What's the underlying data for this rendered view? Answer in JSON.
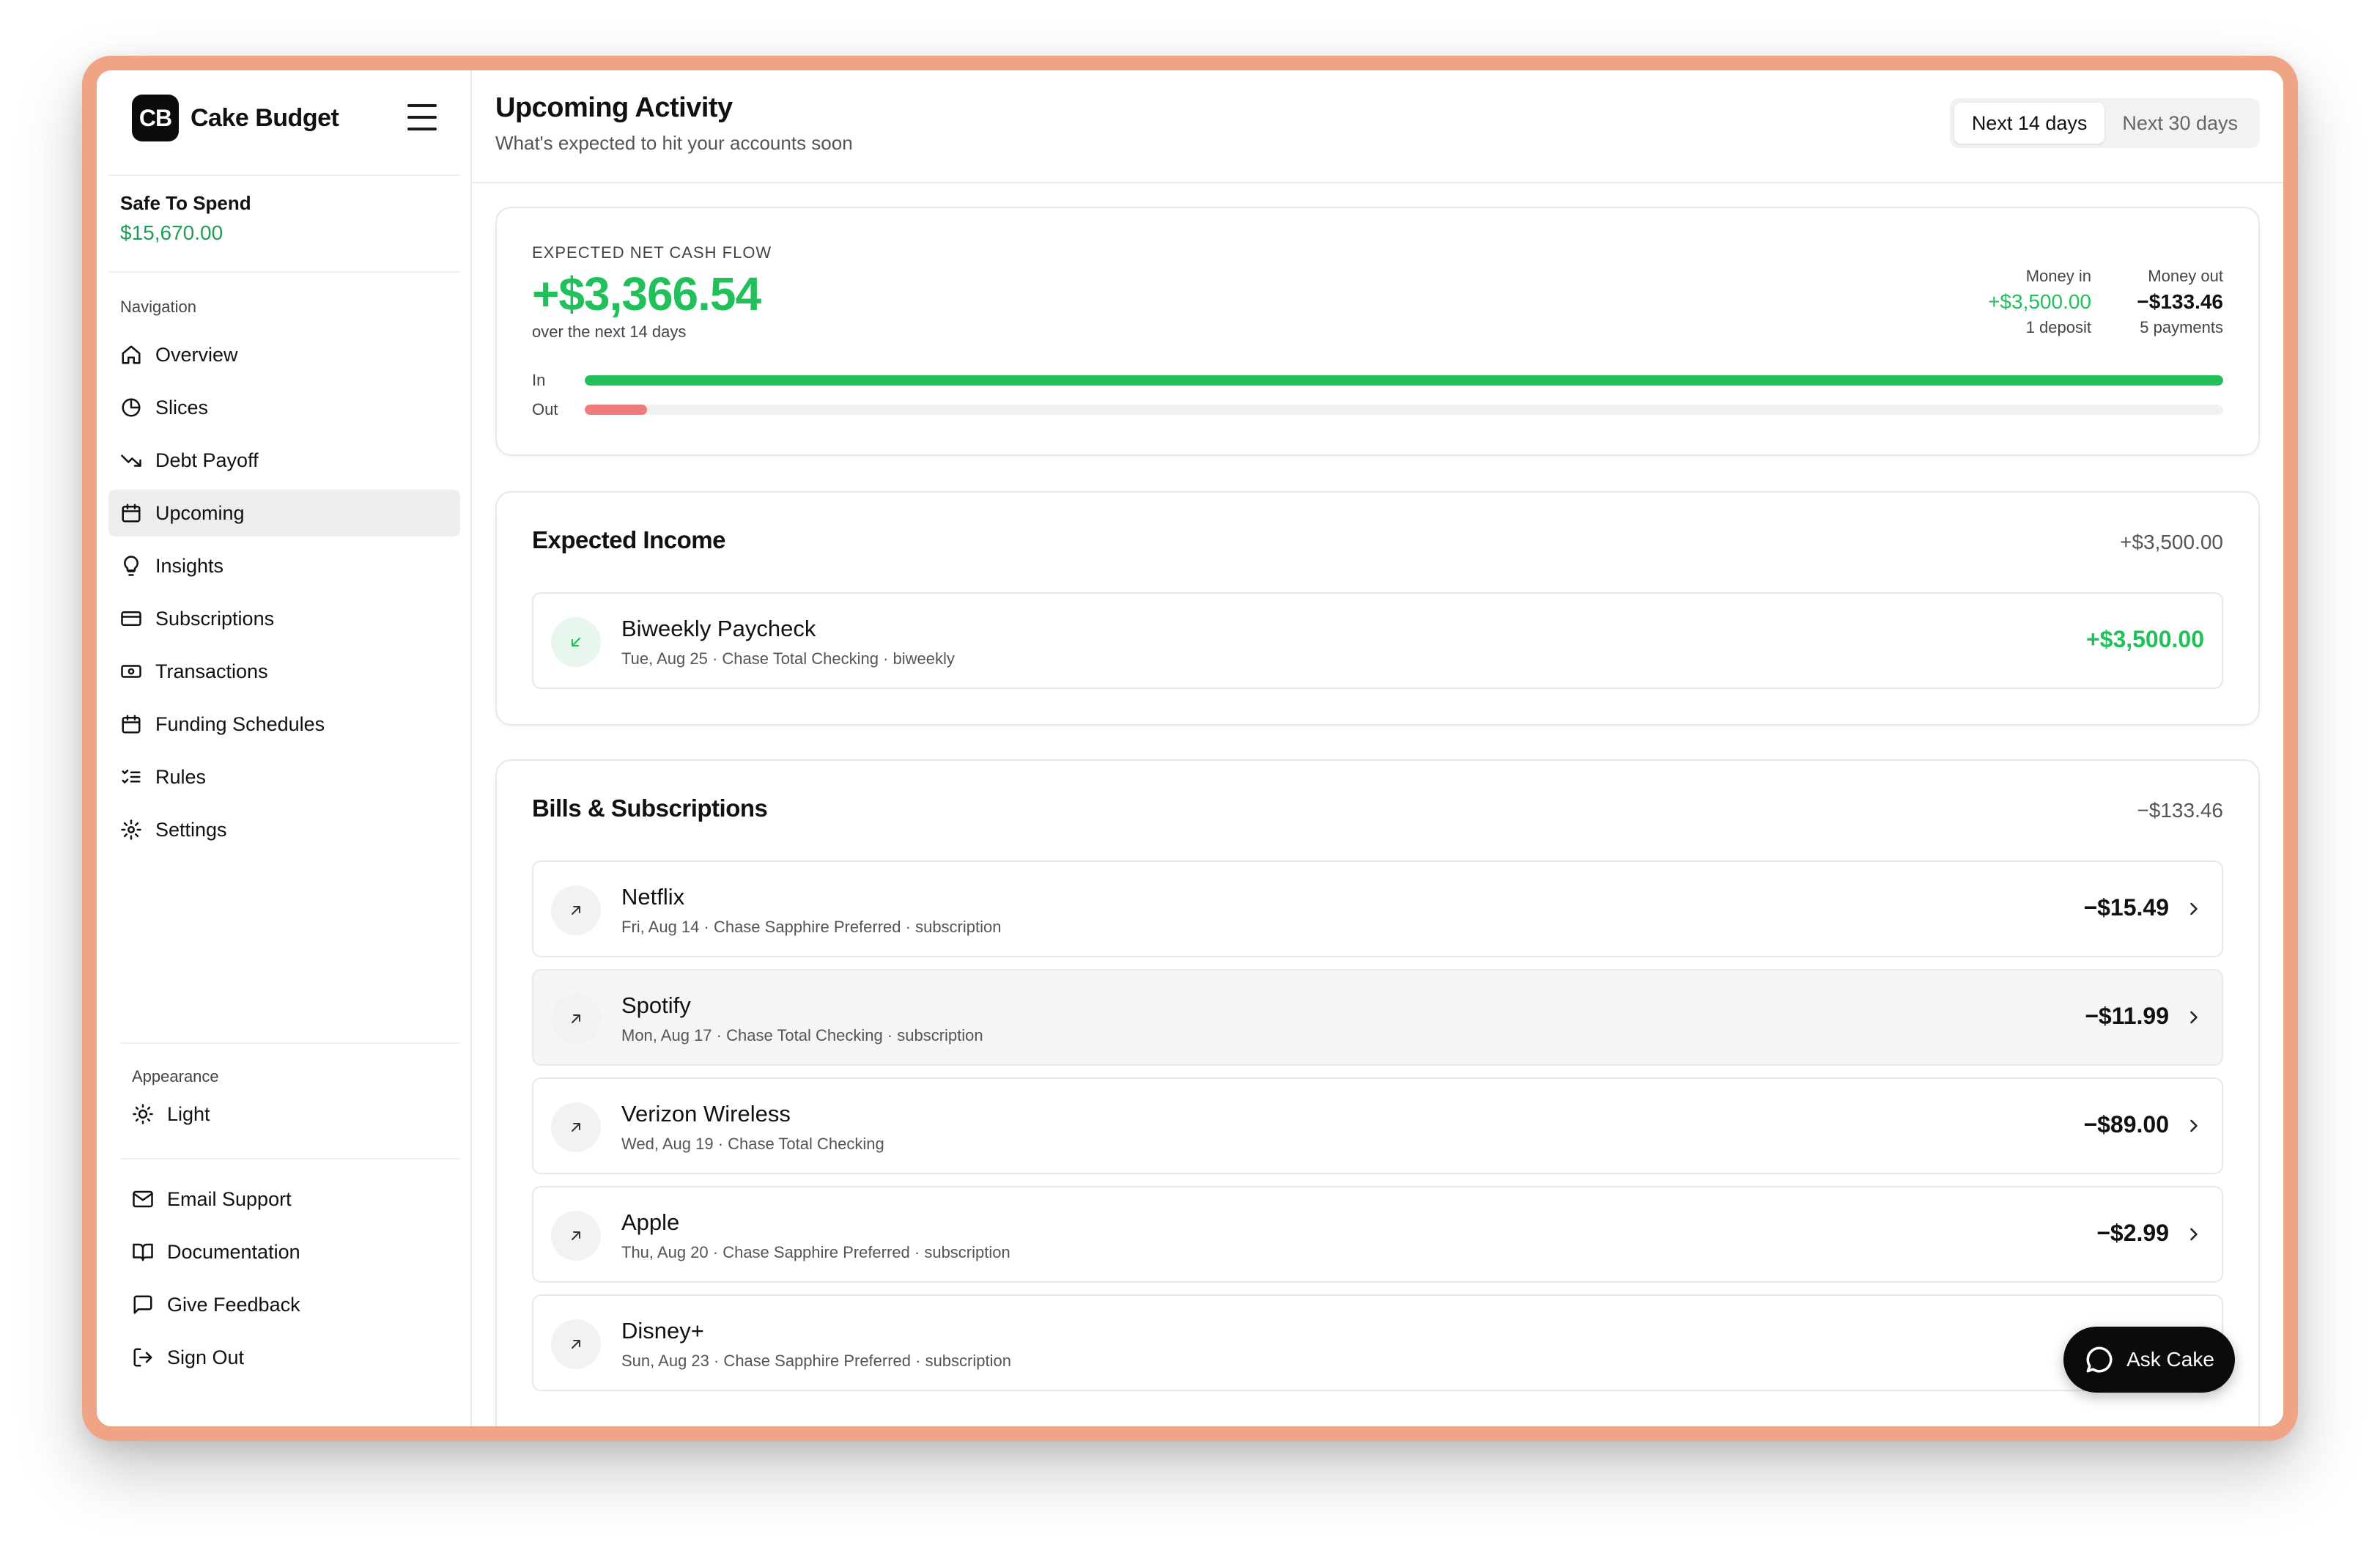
{
  "brand": {
    "logo_text": "CB",
    "name": "Cake Budget"
  },
  "safe_to_spend": {
    "label": "Safe To Spend",
    "value": "$15,670.00"
  },
  "nav": {
    "title": "Navigation",
    "items": [
      {
        "label": "Overview",
        "icon": "home-icon"
      },
      {
        "label": "Slices",
        "icon": "pie-chart-icon"
      },
      {
        "label": "Debt Payoff",
        "icon": "trend-down-icon"
      },
      {
        "label": "Upcoming",
        "icon": "calendar-icon",
        "active": true
      },
      {
        "label": "Insights",
        "icon": "lightbulb-icon"
      },
      {
        "label": "Subscriptions",
        "icon": "card-icon"
      },
      {
        "label": "Transactions",
        "icon": "banknote-icon"
      },
      {
        "label": "Funding Schedules",
        "icon": "calendar-icon"
      },
      {
        "label": "Rules",
        "icon": "list-checks-icon"
      },
      {
        "label": "Settings",
        "icon": "gear-icon"
      }
    ]
  },
  "appearance": {
    "title": "Appearance",
    "theme_label": "Light"
  },
  "support": [
    {
      "label": "Email Support",
      "icon": "mail-icon"
    },
    {
      "label": "Documentation",
      "icon": "book-icon"
    },
    {
      "label": "Give Feedback",
      "icon": "message-square-icon"
    },
    {
      "label": "Sign Out",
      "icon": "log-out-icon"
    }
  ],
  "header": {
    "title": "Upcoming Activity",
    "subtitle": "What's expected to hit your accounts soon",
    "ranges": [
      {
        "label": "Next 14 days",
        "active": true
      },
      {
        "label": "Next 30 days",
        "active": false
      }
    ]
  },
  "cash_flow": {
    "label": "EXPECTED NET CASH FLOW",
    "value": "+$3,366.54",
    "sub": "over the next 14 days",
    "money_in": {
      "label": "Money in",
      "value": "+$3,500.00",
      "count": "1 deposit"
    },
    "money_out": {
      "label": "Money out",
      "value": "−$133.46",
      "count": "5 payments"
    },
    "bars": [
      {
        "label": "In",
        "fraction": 1.0,
        "color": "#22c05a"
      },
      {
        "label": "Out",
        "fraction": 0.038,
        "color": "#f07b7b"
      }
    ]
  },
  "income": {
    "title": "Expected Income",
    "total": "+$3,500.00",
    "items": [
      {
        "name": "Biweekly Paycheck",
        "meta": "Tue, Aug 25 · Chase Total Checking · biweekly",
        "amount": "+$3,500.00"
      }
    ]
  },
  "bills": {
    "title": "Bills & Subscriptions",
    "total": "−$133.46",
    "items": [
      {
        "name": "Netflix",
        "meta": "Fri, Aug 14 · Chase Sapphire Preferred · subscription",
        "amount": "−$15.49"
      },
      {
        "name": "Spotify",
        "meta": "Mon, Aug 17 · Chase Total Checking · subscription",
        "amount": "−$11.99"
      },
      {
        "name": "Verizon Wireless",
        "meta": "Wed, Aug 19 · Chase Total Checking",
        "amount": "−$89.00"
      },
      {
        "name": "Apple",
        "meta": "Thu, Aug 20 · Chase Sapphire Preferred · subscription",
        "amount": "−$2.99"
      },
      {
        "name": "Disney+",
        "meta": "Sun, Aug 23 · Chase Sapphire Preferred · subscription",
        "amount": ""
      }
    ]
  },
  "ask_button": {
    "label": "Ask Cake"
  },
  "colors": {
    "accent_green": "#22c05a",
    "out_red": "#f07b7b",
    "frame": "#f0a486"
  }
}
